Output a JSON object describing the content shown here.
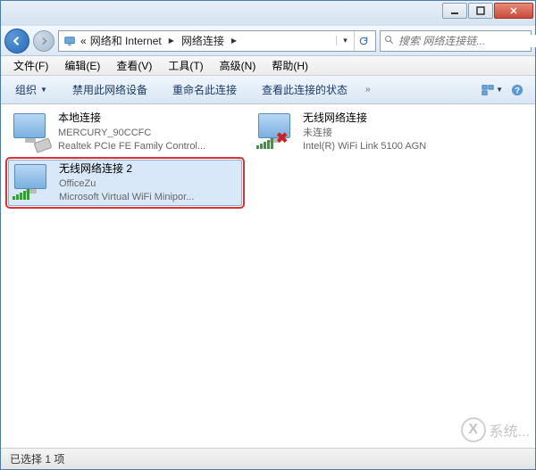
{
  "titlebar": {
    "minimize_label": "_",
    "maximize_label": "□",
    "close_label": "×"
  },
  "breadcrumb": {
    "prefix": "«",
    "part1": "网络和 Internet",
    "part2": "网络连接"
  },
  "search": {
    "placeholder": "搜索 网络连接链..."
  },
  "menu": {
    "file": "文件(F)",
    "edit": "编辑(E)",
    "view": "查看(V)",
    "tools": "工具(T)",
    "advanced": "高级(N)",
    "help": "帮助(H)"
  },
  "toolbar": {
    "organize": "组织",
    "disable": "禁用此网络设备",
    "rename": "重命名此连接",
    "status": "查看此连接的状态",
    "overflow": "»"
  },
  "connections": [
    {
      "name": "本地连接",
      "status": "MERCURY_90CCFC",
      "device": "Realtek PCIe FE Family Control...",
      "type": "wired",
      "selected": false,
      "disconnected": false
    },
    {
      "name": "无线网络连接",
      "status": "未连接",
      "device": "Intel(R) WiFi Link 5100 AGN",
      "type": "wireless",
      "selected": false,
      "disconnected": true
    },
    {
      "name": "无线网络连接 2",
      "status": "OfficeZu",
      "device": "Microsoft Virtual WiFi Minipor...",
      "type": "wireless",
      "selected": true,
      "disconnected": false
    }
  ],
  "statusbar": {
    "text": "已选择 1 项"
  },
  "watermark": {
    "text": "系统..."
  }
}
